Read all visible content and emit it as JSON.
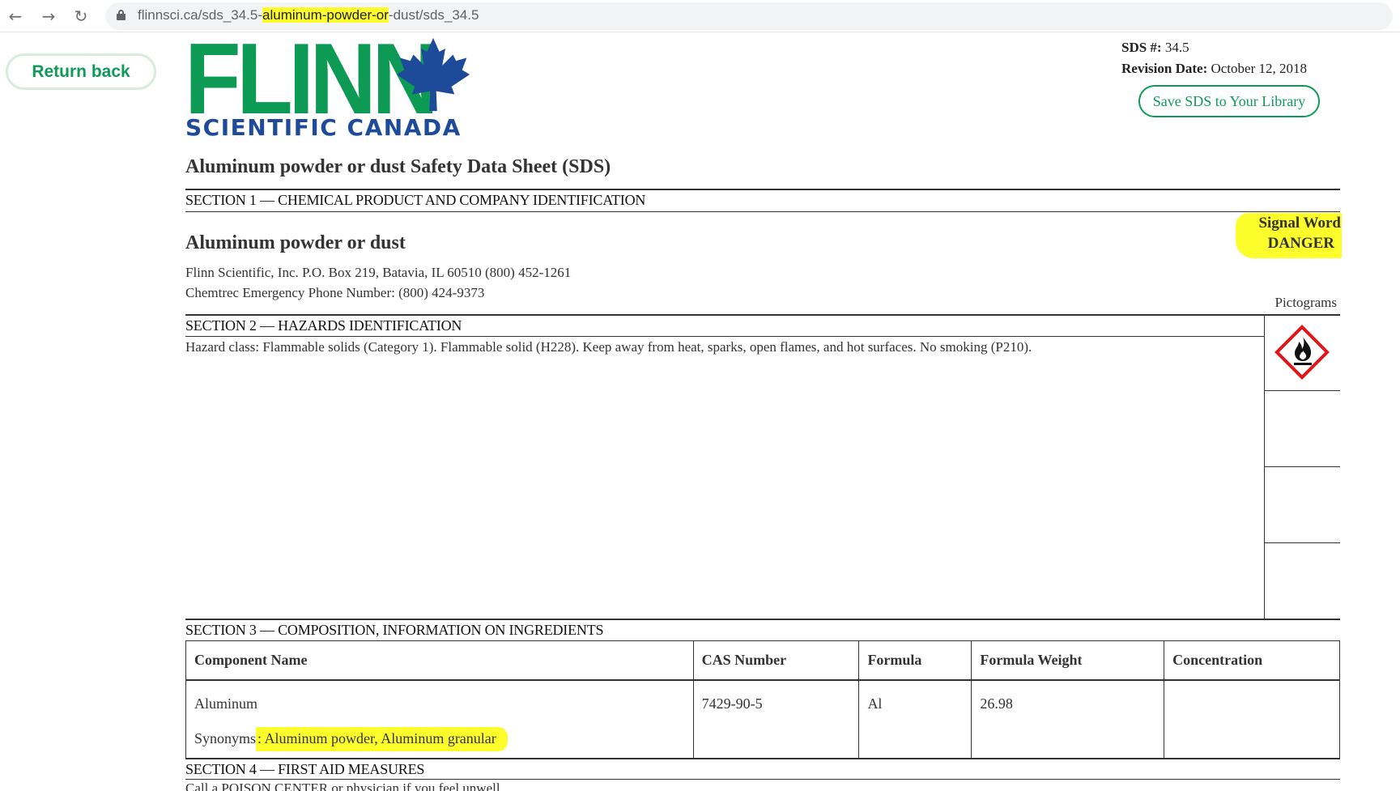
{
  "browser": {
    "url_prefix": "flinnsci.ca/sds_34.5-",
    "url_highlight": "aluminum-powder-or",
    "url_suffix": "-dust/sds_34.5"
  },
  "nav": {
    "return_label": "Return back"
  },
  "logo": {
    "main": "FLINN",
    "sub": "SCIENTIFIC CANADA"
  },
  "meta": {
    "sds_label": "SDS #:",
    "sds_value": "34.5",
    "revision_label": "Revision Date:",
    "revision_value": "October 12, 2018",
    "save_label": "Save SDS to Your Library"
  },
  "document": {
    "title": "Aluminum powder or dust Safety Data Sheet (SDS)",
    "section1": {
      "heading": "SECTION 1 — CHEMICAL PRODUCT AND COMPANY IDENTIFICATION",
      "product_name": "Aluminum powder or dust",
      "company_line": "Flinn Scientific, Inc. P.O. Box 219, Batavia, IL 60510 (800) 452-1261",
      "emergency_line": "Chemtrec Emergency Phone Number: (800) 424-9373",
      "signal_word_label": "Signal Word",
      "signal_word": "DANGER",
      "pictograms_label": "Pictograms"
    },
    "section2": {
      "heading": "SECTION 2 — HAZARDS IDENTIFICATION",
      "hazard_text": "Hazard class: Flammable solids (Category 1). Flammable solid (H228). Keep away from heat, sparks, open flames, and hot surfaces. No smoking (P210)."
    },
    "section3": {
      "heading": "SECTION 3 — COMPOSITION, INFORMATION ON INGREDIENTS",
      "columns": [
        "Component Name",
        "CAS Number",
        "Formula",
        "Formula Weight",
        "Concentration"
      ],
      "row": {
        "component": "Aluminum",
        "synonyms_label": "Synonyms",
        "synonyms_value": ": Aluminum powder, Aluminum granular",
        "cas": "7429-90-5",
        "formula": "Al",
        "weight": "26.98",
        "concentration": ""
      }
    },
    "section4": {
      "heading": "SECTION 4 — FIRST AID MEASURES",
      "text": "Call a POISON CENTER or physician if you feel unwell."
    }
  },
  "colors": {
    "brand_green": "#0d9a55",
    "brand_blue": "#1d4b9a",
    "highlight": "#fdfd2b",
    "hazard_red": "#e0161a"
  },
  "icons": {
    "back": "arrow-left-icon",
    "forward": "arrow-right-icon",
    "reload": "reload-icon",
    "lock": "lock-icon",
    "logo_leaf": "maple-leaf-icon",
    "pictogram": "flame-pictogram-icon"
  }
}
